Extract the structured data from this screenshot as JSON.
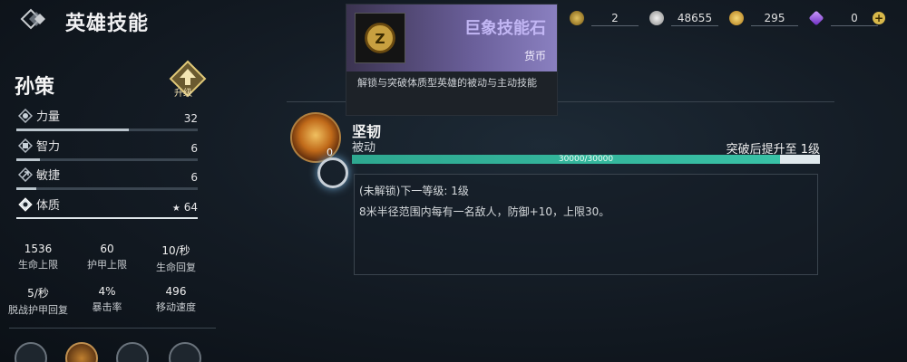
{
  "header": {
    "title": "英雄技能"
  },
  "currency": [
    {
      "icon": "skill-stone-icon",
      "value": "2"
    },
    {
      "icon": "silver-coin-icon",
      "value": "48655"
    },
    {
      "icon": "gold-coin-icon",
      "value": "295"
    },
    {
      "icon": "purple-crystal-icon",
      "value": "0"
    }
  ],
  "hero": {
    "name": "孙策",
    "upgrade_label": "升级",
    "stats": [
      {
        "icon": "strength-icon",
        "label": "力量",
        "value": "32",
        "fill": 0.62
      },
      {
        "icon": "intellect-icon",
        "label": "智力",
        "value": "6",
        "fill": 0.13
      },
      {
        "icon": "agility-icon",
        "label": "敏捷",
        "value": "6",
        "fill": 0.11
      },
      {
        "icon": "constitution-icon",
        "label": "体质",
        "value": "64",
        "fill": 1.0
      }
    ],
    "attributes": [
      {
        "value": "1536",
        "label": "生命上限"
      },
      {
        "value": "60",
        "label": "护甲上限"
      },
      {
        "value": "10/秒",
        "label": "生命回复"
      },
      {
        "value": "5/秒",
        "label": "脱战护甲回复"
      },
      {
        "value": "4%",
        "label": "暴击率"
      },
      {
        "value": "496",
        "label": "移动速度"
      }
    ]
  },
  "tooltip": {
    "item_name": "巨象技能石",
    "tag": "货币",
    "description": "解锁与突破体质型英雄的被动与主动技能"
  },
  "skill": {
    "name": "坚韧",
    "type": "被动",
    "count": "0",
    "breakthrough": "突破后提升至 1级",
    "progress_text": "30000/30000",
    "progress": 1.0,
    "next_level": "(未解锁)下一等级: 1级",
    "effect": "8米半径范围内每有一名敌人，防御+10，上限30。"
  },
  "colors": {
    "accent_teal": "#3ac4a8",
    "tooltip_purple": "#c2b6f4"
  }
}
